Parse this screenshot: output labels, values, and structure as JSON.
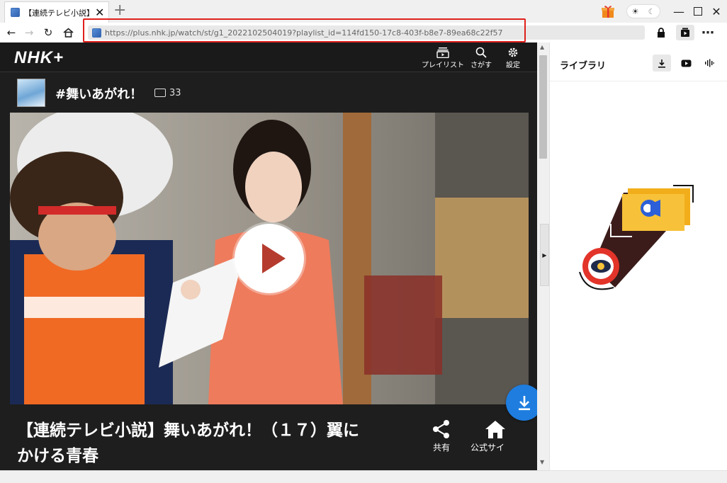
{
  "browser": {
    "tab_title": "【連続テレビ小説】舞",
    "url": "https://plus.nhk.jp/watch/st/g1_2022102504019?playlist_id=114fd150-17c8-403f-b8e7-89ea68c22f57"
  },
  "page": {
    "logo": "NHK+",
    "nav": {
      "playlist": "プレイリスト",
      "search": "さがす",
      "settings": "設定"
    },
    "series_title": "#舞いあがれ！",
    "comment_count": "33",
    "episode_title_line1": "【連続テレビ小説】舞いあがれ！（１７）翼に",
    "episode_title_line2": "かける青春",
    "actions": {
      "share": "共有",
      "official": "公式サイ"
    }
  },
  "library": {
    "title": "ライブラリ"
  },
  "colors": {
    "highlight": "#e0201c",
    "download_fab": "#1e7ddf",
    "play_triangle": "#b53b2e"
  }
}
